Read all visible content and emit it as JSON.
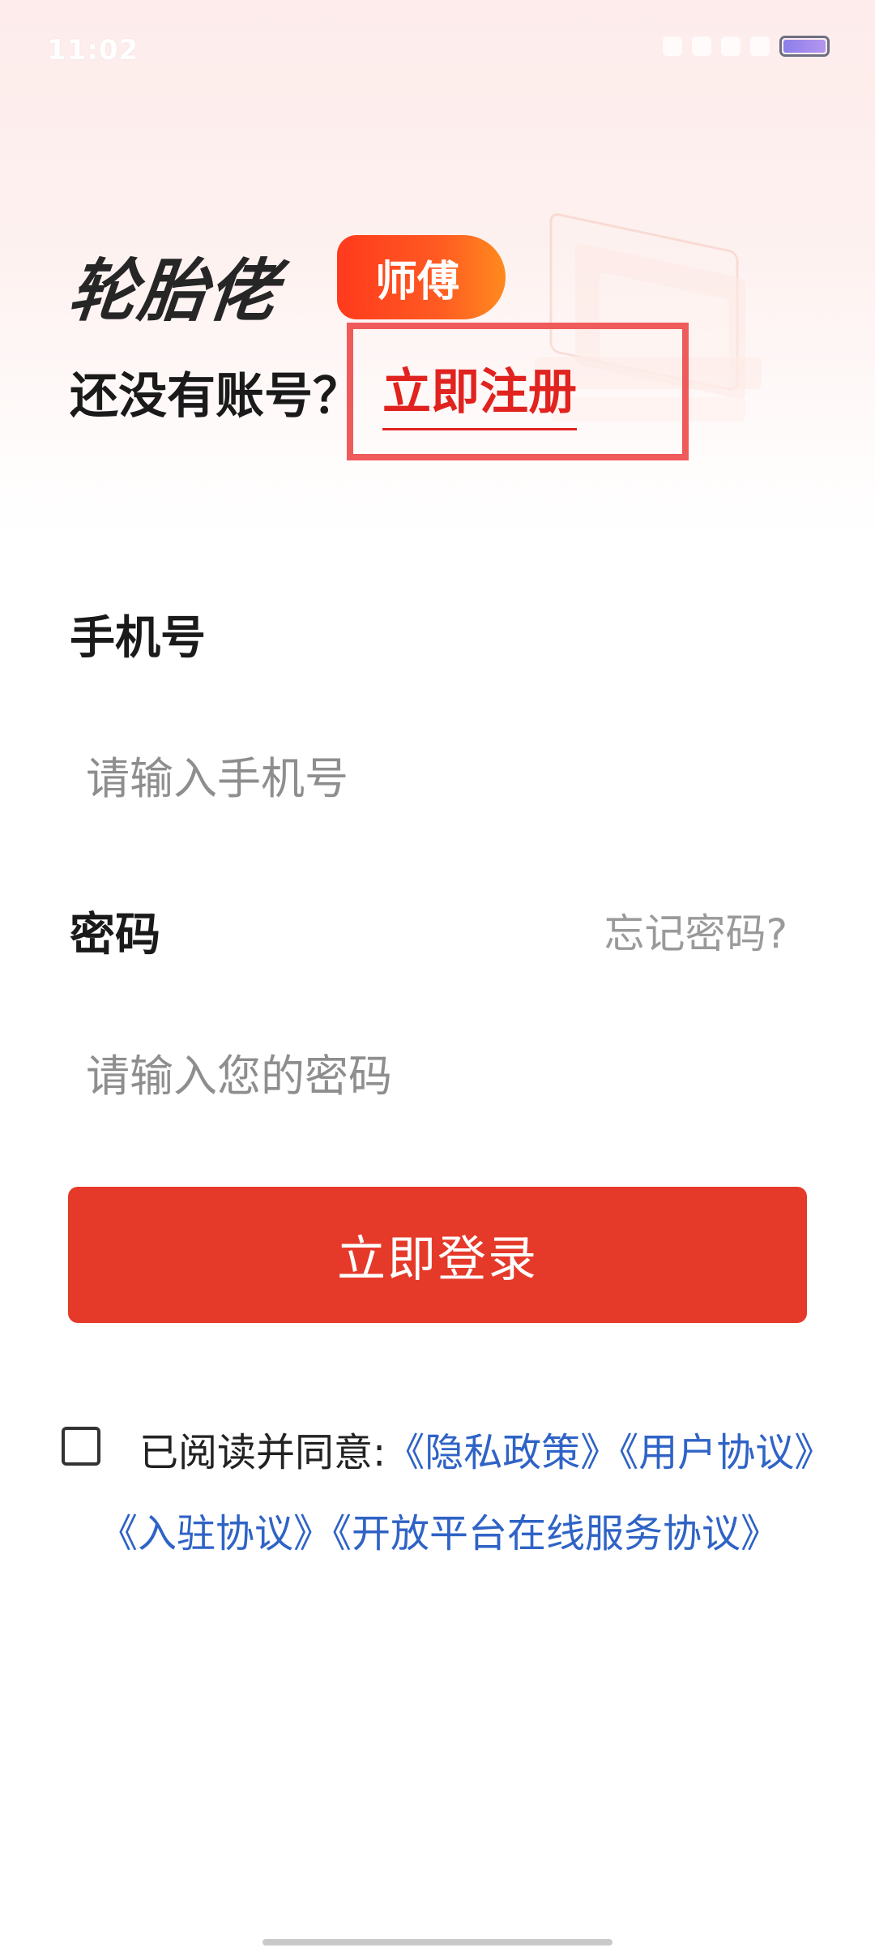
{
  "status_bar": {
    "time": "11:02"
  },
  "brand": {
    "logo_text": "轮胎佬",
    "badge_text": "师傅",
    "accent_color": "#e0231f",
    "button_color": "#e53a2a",
    "link_color": "#2f63c6"
  },
  "register": {
    "prompt": "还没有账号？",
    "link_label": "立即注册"
  },
  "phone": {
    "label": "手机号",
    "placeholder": "请输入手机号"
  },
  "password": {
    "label": "密码",
    "placeholder": "请输入您的密码",
    "forgot_label": "忘记密码?"
  },
  "login": {
    "button_label": "立即登录"
  },
  "agreement": {
    "prefix": "已阅读并同意:",
    "checked": false,
    "links": [
      "《隐私政策》",
      "《用户协议》",
      "《入驻协议》",
      "《开放平台在线服务协议》"
    ]
  },
  "icons": {
    "status": [
      "alarm-icon",
      "signal-icon",
      "photo-icon",
      "wifi-icon",
      "battery-icon"
    ],
    "agreement": "checkbox-icon"
  }
}
